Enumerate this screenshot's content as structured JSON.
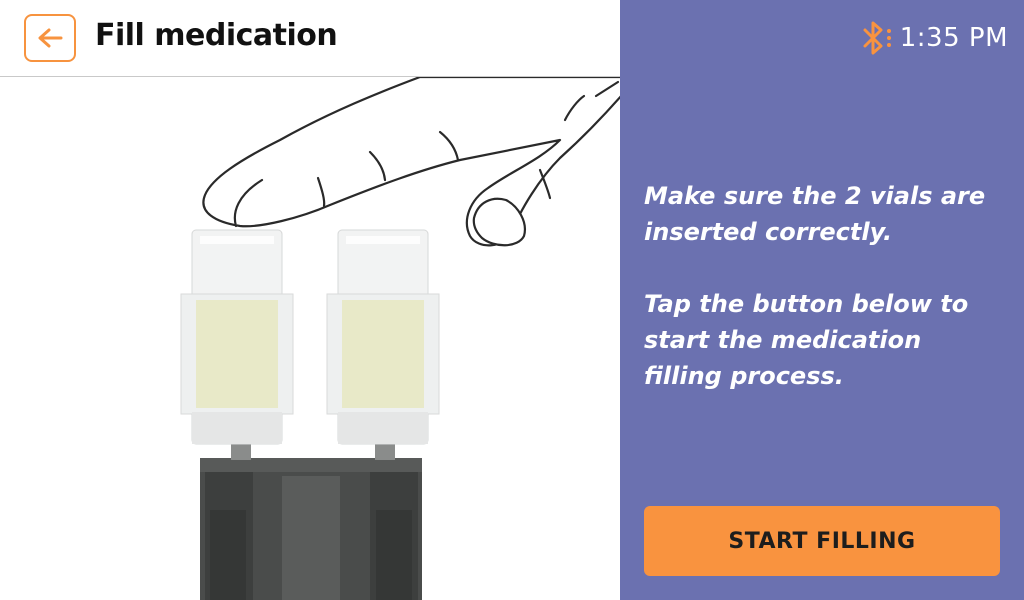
{
  "header": {
    "title": "Fill medication",
    "back_icon": "arrow-left-icon"
  },
  "status_bar": {
    "bluetooth_icon": "bluetooth-icon",
    "time": "1:35 PM"
  },
  "instructions": {
    "line1": "Make sure the 2 vials are inserted correctly.",
    "line2": "Tap the button below to start the medication filling process."
  },
  "action": {
    "start_label": "START FILLING"
  },
  "colors": {
    "accent": "#f9933f",
    "panel": "#6b71b0",
    "liquid": "#e8e9c8"
  }
}
